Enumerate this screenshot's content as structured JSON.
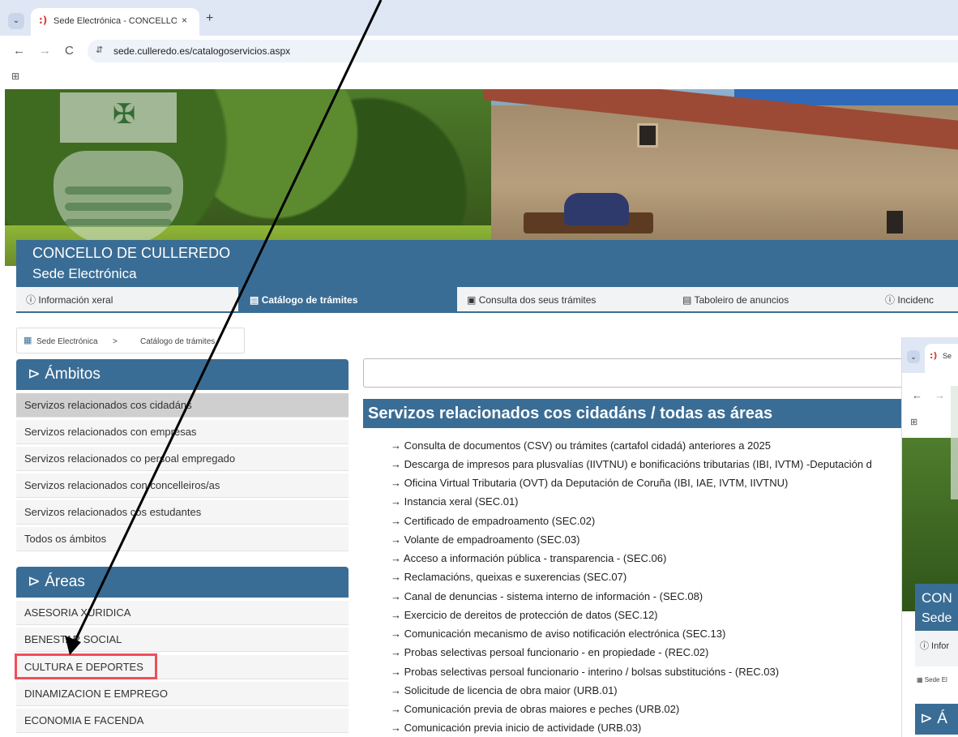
{
  "browser": {
    "tab_title": "Sede Electrónica - CONCELLO D",
    "tab_favicon": ":)",
    "tab_close": "×",
    "new_tab": "+",
    "tab_menu": "⌄",
    "back": "←",
    "forward": "→",
    "reload": "C",
    "site_info": "⇵",
    "url": "sede.culleredo.es/catalogoservicios.aspx",
    "apps_icon": "⊞"
  },
  "site": {
    "name": "CONCELLO DE CULLEREDO",
    "subtitle": "Sede Electrónica"
  },
  "mainnav": {
    "items": [
      {
        "icon": "ⓘ",
        "label": "Información xeral"
      },
      {
        "icon": "▤",
        "label": "Catálogo de trámites"
      },
      {
        "icon": "▣",
        "label": "Consulta dos seus trámites"
      },
      {
        "icon": "▤",
        "label": "Taboleiro de anuncios"
      },
      {
        "icon": "ⓘ",
        "label": "Incidenc"
      }
    ]
  },
  "breadcrumb": {
    "icon": "▦",
    "home": "Sede Electrónica",
    "separator": ">",
    "current": "Catálogo de trámites"
  },
  "ambitos": {
    "title": "⊳ Ámbitos",
    "items": [
      "Servizos relacionados cos cidadáns",
      "Servizos relacionados con empresas",
      "Servizos relacionados co persoal empregado",
      "Servizos relacionados con concelleiros/as",
      "Servizos relacionados cos estudantes",
      "Todos os ámbitos"
    ]
  },
  "areas": {
    "title": "⊳ Áreas",
    "items": [
      "ASESORIA XURIDICA",
      "BENESTAR SOCIAL",
      "CULTURA E DEPORTES",
      "DINAMIZACION E EMPREGO",
      "ECONOMIA E FACENDA"
    ]
  },
  "content": {
    "search_placeholder": "",
    "heading": "Servizos relacionados cos cidadáns / todas as áreas",
    "services": [
      "→ Consulta de documentos (CSV) ou trámites (cartafol cidadá) anteriores a 2025",
      "→ Descarga de impresos para plusvalías (IIVTNU) e bonificacións tributarias (IBI, IVTM) -Deputación d",
      "→ Oficina Virtual Tributaria (OVT) da Deputación de Coruña (IBI, IAE, IVTM, IIVTNU)",
      "→ Instancia xeral (SEC.01)",
      "→ Certificado de empadroamento (SEC.02)",
      "→ Volante de empadroamento (SEC.03)",
      "→ Acceso a información pública - transparencia - (SEC.06)",
      "→ Reclamacións, queixas e suxerencias (SEC.07)",
      "→ Canal de denuncias - sistema interno de información - (SEC.08)",
      "→ Exercicio de dereitos de protección de datos (SEC.12)",
      "→ Comunicación mecanismo de aviso notificación electrónica (SEC.13)",
      "→ Probas selectivas persoal funcionario - en propiedade - (REC.02)",
      "→ Probas selectivas persoal funcionario - interino / bolsas substitucións - (REC.03)",
      "→ Solicitude de licencia de obra maior (URB.01)",
      "→ Comunicación previa de obras maiores e peches (URB.02)",
      "→ Comunicación previa inicio de actividade (URB.03)"
    ]
  },
  "overlay": {
    "tab_fragment": "Se",
    "site_name_fragment": "CON",
    "site_sub_fragment": "Sede",
    "nav_fragment": "ⓘ Infor",
    "bc_fragment": "▦ Sede El",
    "panel_fragment": "⊳ Á"
  },
  "colors": {
    "brand": "#3a6d95",
    "highlight": "#f04e5a",
    "selected_item": "#cfcfcf"
  }
}
